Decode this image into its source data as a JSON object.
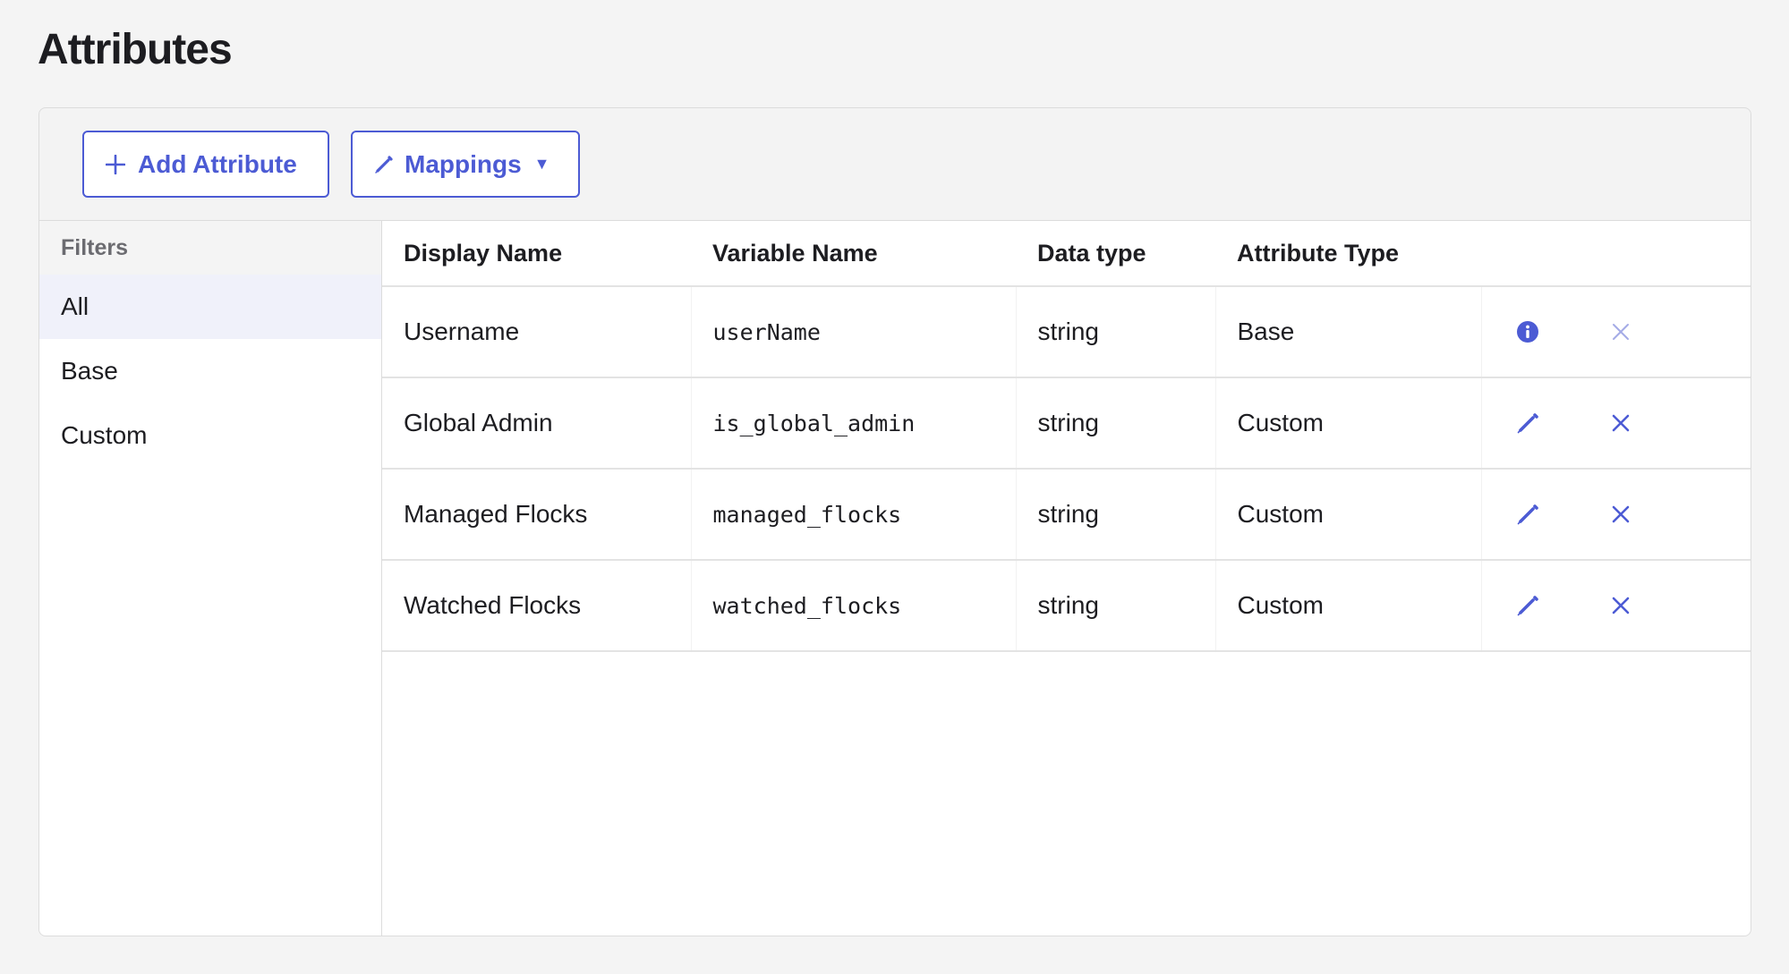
{
  "page": {
    "title": "Attributes"
  },
  "toolbar": {
    "add_label": "Add Attribute",
    "mappings_label": "Mappings"
  },
  "filters": {
    "heading": "Filters",
    "items": [
      {
        "label": "All",
        "active": true
      },
      {
        "label": "Base",
        "active": false
      },
      {
        "label": "Custom",
        "active": false
      }
    ]
  },
  "table": {
    "columns": [
      "Display Name",
      "Variable Name",
      "Data type",
      "Attribute Type"
    ],
    "rows": [
      {
        "display_name": "Username",
        "variable_name": "userName",
        "data_type": "string",
        "attribute_type": "Base",
        "action_icon": "info-icon",
        "delete_enabled": false
      },
      {
        "display_name": "Global Admin",
        "variable_name": "is_global_admin",
        "data_type": "string",
        "attribute_type": "Custom",
        "action_icon": "pencil-icon",
        "delete_enabled": true
      },
      {
        "display_name": "Managed Flocks",
        "variable_name": "managed_flocks",
        "data_type": "string",
        "attribute_type": "Custom",
        "action_icon": "pencil-icon",
        "delete_enabled": true
      },
      {
        "display_name": "Watched Flocks",
        "variable_name": "watched_flocks",
        "data_type": "string",
        "attribute_type": "Custom",
        "action_icon": "pencil-icon",
        "delete_enabled": true
      }
    ]
  },
  "colors": {
    "accent": "#4c5bd4",
    "accent_disabled": "#a4abe6",
    "page_bg": "#f4f4f4",
    "active_filter_bg": "#f0f1fa"
  }
}
